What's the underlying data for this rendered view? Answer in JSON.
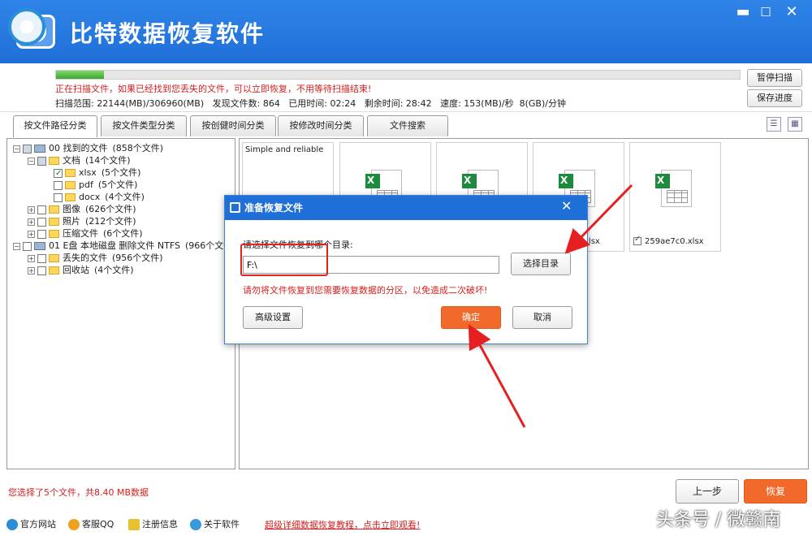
{
  "window": {
    "title": "比特数据恢复软件",
    "minimize": "▬",
    "maximize": "☐",
    "close": "✕"
  },
  "scan": {
    "progress": 0.07,
    "warning": "正在扫描文件，如果已经找到您丢失的文件，可以立即恢复，不用等待扫描结束!",
    "stats": "扫描范围: 22144(MB)/306960(MB)   发现文件数: 864   已用时间: 02:24   剩余时间: 28:42   速度: 153(MB)/秒  8(GB)/分钟",
    "pause_label": "暂停扫描",
    "save_label": "保存进度"
  },
  "tabs": [
    {
      "label": "按文件路径分类"
    },
    {
      "label": "按文件类型分类"
    },
    {
      "label": "按创健时间分类"
    },
    {
      "label": "按修改时间分类"
    },
    {
      "label": "文件搜索"
    }
  ],
  "tree": [
    {
      "exp": "−",
      "name": "00 找到的文件",
      "count": "(858个文件)"
    },
    {
      "exp": "−",
      "name": "文档",
      "count": "(14个文件)"
    },
    {
      "exp": "",
      "name": "xlsx",
      "count": "(5个文件)"
    },
    {
      "exp": "",
      "name": "pdf",
      "count": "(5个文件)"
    },
    {
      "exp": "",
      "name": "docx",
      "count": "(4个文件)"
    },
    {
      "exp": "+",
      "name": "图像",
      "count": "(626个文件)"
    },
    {
      "exp": "+",
      "name": "照片",
      "count": "(212个文件)"
    },
    {
      "exp": "+",
      "name": "压缩文件",
      "count": "(6个文件)"
    },
    {
      "exp": "−",
      "name": "01 E盘 本地磁盘 删除文件 NTFS",
      "count": "(966个文件"
    },
    {
      "exp": "+",
      "name": "丢失的文件",
      "count": "(956个文件)"
    },
    {
      "exp": "+",
      "name": "回收站",
      "count": "(4个文件)"
    }
  ],
  "tiles": [
    {
      "name": "Simple and reliable",
      "icon": "text-preview"
    },
    {
      "name": "",
      "icon": "xlsx-icon"
    },
    {
      "name": "",
      "icon": "xlsx-icon"
    },
    {
      "name": "xlsx",
      "icon": "xlsx-icon"
    },
    {
      "name": "259ae7c0.xlsx",
      "icon": "xlsx-icon"
    }
  ],
  "dialog": {
    "title": "准备恢复文件",
    "close": "✕",
    "prompt": "请选择文件恢复到哪个目录:",
    "path_value": "F:\\",
    "browse_label": "选择目录",
    "warning": "请勿将文件恢复到您需要恢复数据的分区，以免造成二次破坏!",
    "advanced_label": "高级设置",
    "ok_label": "确定",
    "cancel_label": "取消"
  },
  "footer": {
    "selection": "您选择了5个文件，共8.40 MB数据",
    "back_label": "上一步",
    "recover_label": "恢复",
    "links": [
      "官方网站",
      "客服QQ",
      "注册信息",
      "关于软件"
    ],
    "tutorial": "超级详细数据恢复教程，点击立即观看!",
    "watermark": "头条号 / 微赣南"
  },
  "colors": {
    "brand_blue": "#1f6fd8",
    "accent_orange": "#f26a2b",
    "warning_red": "#d62020",
    "annotation_red": "#e62020"
  }
}
